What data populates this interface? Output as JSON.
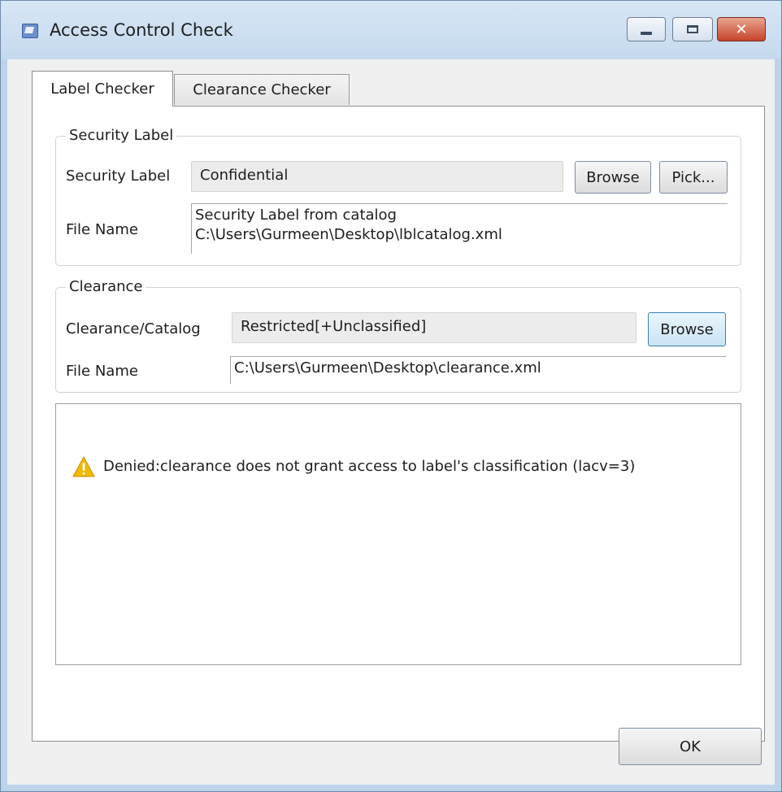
{
  "window": {
    "title": "Access Control Check",
    "icon": "app-icon",
    "controls": {
      "minimize": "minimize-icon",
      "maximize": "maximize-icon",
      "close": "✕"
    }
  },
  "tabs": [
    {
      "label": "Label Checker",
      "active": true
    },
    {
      "label": "Clearance Checker",
      "active": false
    }
  ],
  "security_label_group": {
    "legend": "Security Label",
    "label_caption": "Security Label",
    "label_value": "Confidential",
    "browse_label": "Browse",
    "pick_label": "Pick...",
    "file_caption": "File Name",
    "file_line1": "Security Label from catalog",
    "file_line2": "C:\\Users\\Gurmeen\\Desktop\\lblcatalog.xml"
  },
  "clearance_group": {
    "legend": "Clearance",
    "clearance_caption": "Clearance/Catalog",
    "clearance_value": "Restricted[+Unclassified]",
    "browse_label": "Browse",
    "file_caption": "File Name",
    "file_value": "C:\\Users\\Gurmeen\\Desktop\\clearance.xml"
  },
  "result": {
    "icon": "warning-icon",
    "message": "Denied:clearance does not grant access to label's classification (lacv=3)"
  },
  "footer": {
    "ok_label": "OK"
  },
  "colors": {
    "warning": "#f2b800",
    "title_bar": "#c5d9ee",
    "close_button": "#c6432b"
  }
}
